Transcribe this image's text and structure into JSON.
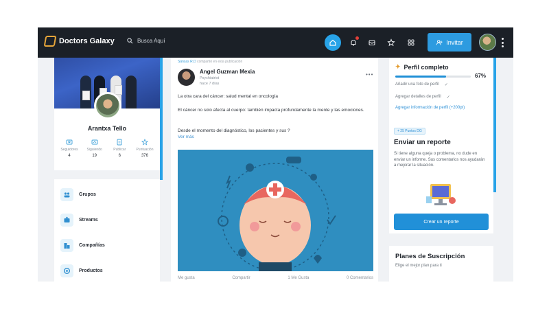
{
  "app": {
    "brand": "Doctors Galaxy"
  },
  "header": {
    "search_placeholder": "Busca Aquí",
    "invite_label": "Invitar",
    "nav_icons": [
      "home-icon",
      "bell-icon",
      "inbox-icon",
      "star-icon",
      "apps-icon"
    ]
  },
  "profile": {
    "name": "Arantxa Tello",
    "stats": [
      {
        "label": "Seguidores",
        "value": "4",
        "icon": "followers-icon"
      },
      {
        "label": "Siguiendo",
        "value": "19",
        "icon": "following-icon"
      },
      {
        "label": "Publicar",
        "value": "6",
        "icon": "posts-icon"
      },
      {
        "label": "Puntuación",
        "value": "376",
        "icon": "score-icon"
      }
    ]
  },
  "menu": {
    "items": [
      {
        "label": "Grupos",
        "icon": "groups-icon"
      },
      {
        "label": "Streams",
        "icon": "streams-icon"
      },
      {
        "label": "Compañías",
        "icon": "companies-icon"
      },
      {
        "label": "Productos",
        "icon": "products-icon"
      }
    ]
  },
  "post": {
    "shared_by": "Sánsas R.D",
    "shared_text": "compartió en esta publicación",
    "author_name": "Angel Guzman Mexia",
    "author_role": "Psychiatrist",
    "author_time": "hace 7 días",
    "paragraphs": [
      "La otra cara del cáncer: salud mental en oncología",
      "El cáncer no solo afecta al cuerpo: también impacta profundamente la mente y las emociones.",
      "Desde el momento del diagnóstico, los pacientes y sus ?"
    ],
    "see_more": "Ver más",
    "actions": {
      "like": "Me gusta",
      "share": "Compartir",
      "likes_count": "1 Me Gusta",
      "comments_count": "0 Comentarios"
    }
  },
  "profile_complete": {
    "title": "Perfil completo",
    "percent": 67,
    "percent_label": "67%",
    "items": [
      "Añadir una foto de perfil",
      "Agregar detalles de perfil"
    ],
    "link": "Agregar información de perfil (+200pt)"
  },
  "report": {
    "badge": "+ 25 Puntos DG",
    "title": "Enviar un reporte",
    "text": "Si tiene alguna queja o problema, no dude en enviar un informe. Sus comentarios nos ayudarán a mejorar la situación.",
    "button": "Crear un reporte"
  },
  "plans": {
    "title": "Planes de Suscripción",
    "subtitle": "Elige el mejor plan para ti"
  },
  "colors": {
    "accent": "#28a3e8",
    "topbar": "#1b2027",
    "brand_logo": "#e7a63a"
  }
}
